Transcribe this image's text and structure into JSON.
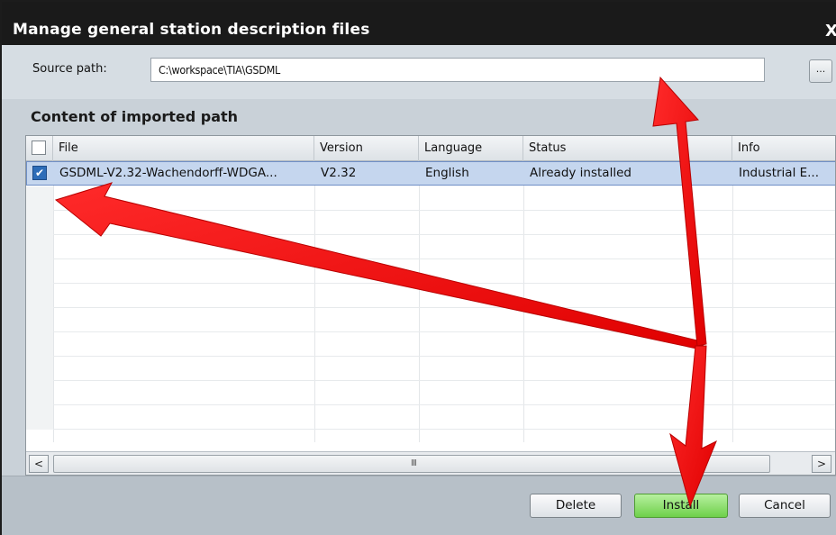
{
  "dialog": {
    "title": "Manage general station description files",
    "close_glyph": "X"
  },
  "source": {
    "label": "Source path:",
    "value": "C:\\workspace\\TIA\\GSDML",
    "browse_label": "..."
  },
  "content": {
    "title": "Content of imported path",
    "columns": [
      "File",
      "Version",
      "Language",
      "Status",
      "Info"
    ],
    "rows": [
      {
        "checked": true,
        "file": "GSDML-V2.32-Wachendorff-WDGA...",
        "version": "V2.32",
        "language": "English",
        "status": "Already installed",
        "info": "Industrial E..."
      }
    ],
    "scrollbar": {
      "left_glyph": "<",
      "right_glyph": ">",
      "grip_glyph": "III"
    }
  },
  "footer": {
    "delete_label": "Delete",
    "install_label": "Install",
    "cancel_label": "Cancel"
  },
  "colors": {
    "title_bar": "#1a1a1a",
    "selected_row": "#c5d6ee",
    "install_button": "#6ed04a",
    "annotation_arrows": "#ff1a1a"
  },
  "icons": {
    "checkbox": "checkbox-icon",
    "annotation": "red-arrow-icon"
  }
}
